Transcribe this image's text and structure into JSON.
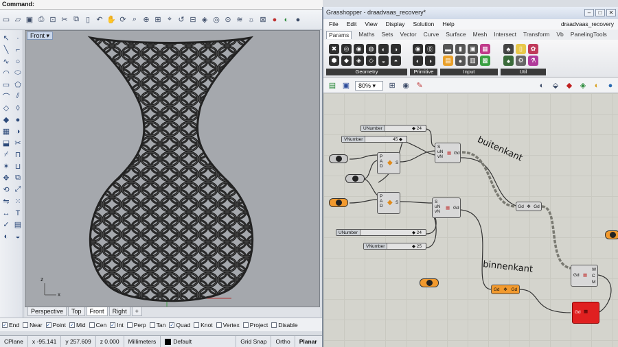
{
  "rhino": {
    "command_label": "Command:",
    "command_value": "",
    "viewport_label": "Front",
    "viewport_tabs": [
      "Perspective",
      "Top",
      "Front",
      "Right",
      "+"
    ],
    "active_tab": "Front",
    "osnaps": [
      {
        "label": "End",
        "checked": true
      },
      {
        "label": "Near",
        "checked": false
      },
      {
        "label": "Point",
        "checked": true
      },
      {
        "label": "Mid",
        "checked": true
      },
      {
        "label": "Cen",
        "checked": false
      },
      {
        "label": "Int",
        "checked": true
      },
      {
        "label": "Perp",
        "checked": false
      },
      {
        "label": "Tan",
        "checked": false
      },
      {
        "label": "Quad",
        "checked": true
      },
      {
        "label": "Knot",
        "checked": false
      },
      {
        "label": "Vertex",
        "checked": false
      },
      {
        "label": "Project",
        "checked": false
      },
      {
        "label": "Disable",
        "checked": false
      }
    ],
    "status": {
      "cplane": "CPlane",
      "x": "x -95.141",
      "y": "y 257.609",
      "z": "z 0.000",
      "units": "Millimeters",
      "layer": "Default",
      "grid_snap": "Grid Snap",
      "ortho": "Ortho",
      "planar": "Planar"
    },
    "axis_x": "x",
    "axis_z": "z"
  },
  "grasshopper": {
    "title": "Grasshopper - draadvaas_recovery*",
    "file_name": "draadvaas_recovery",
    "menu": [
      "File",
      "Edit",
      "View",
      "Display",
      "Solution",
      "Help"
    ],
    "tabs": [
      "Params",
      "Maths",
      "Sets",
      "Vector",
      "Curve",
      "Surface",
      "Mesh",
      "Intersect",
      "Transform",
      "Vb",
      "PanelingTools"
    ],
    "active_tab": "Params",
    "groups": [
      "Geometry",
      "Primitive",
      "Input",
      "Util"
    ],
    "zoom": "80%",
    "sliders": [
      {
        "name": "UNumber",
        "value": "24"
      },
      {
        "name": "VNumber",
        "value": "45"
      },
      {
        "name": "UNumber",
        "value": "24"
      },
      {
        "name": "VNumber",
        "value": "25"
      }
    ],
    "annotations": [
      "buitenkant",
      "binnenkant"
    ]
  }
}
